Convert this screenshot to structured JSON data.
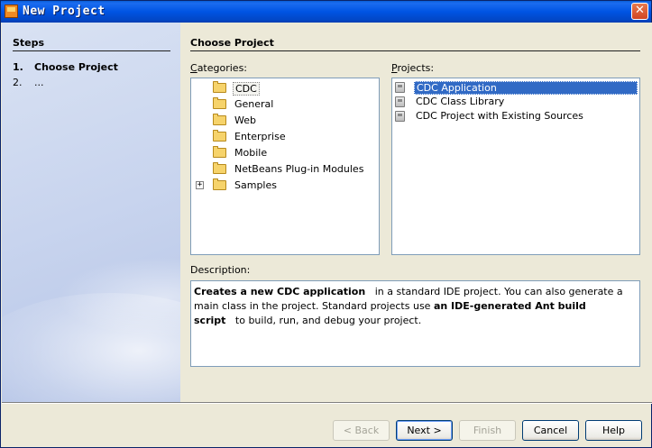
{
  "window": {
    "title": "New Project",
    "close_glyph": "✕",
    "icon": "netbeans-project-icon"
  },
  "steps": {
    "heading": "Steps",
    "items": [
      {
        "num": "1.",
        "label": "Choose Project",
        "current": true
      },
      {
        "num": "2.",
        "label": "...",
        "current": false
      }
    ]
  },
  "main": {
    "heading": "Choose Project",
    "categories_label": "Categories:",
    "projects_label": "Projects:",
    "description_label": "Description:",
    "categories": [
      {
        "label": "CDC",
        "selected": true,
        "expandable": false
      },
      {
        "label": "General",
        "selected": false,
        "expandable": false
      },
      {
        "label": "Web",
        "selected": false,
        "expandable": false
      },
      {
        "label": "Enterprise",
        "selected": false,
        "expandable": false
      },
      {
        "label": "Mobile",
        "selected": false,
        "expandable": false
      },
      {
        "label": "NetBeans Plug-in Modules",
        "selected": false,
        "expandable": false
      },
      {
        "label": "Samples",
        "selected": false,
        "expandable": true
      }
    ],
    "expander_glyph": "+",
    "projects": [
      {
        "label": "CDC Application",
        "selected": true
      },
      {
        "label": "CDC Class Library",
        "selected": false
      },
      {
        "label": "CDC Project with Existing Sources",
        "selected": false
      }
    ],
    "description": {
      "part1_bold": "Creates a new CDC application",
      "part2": "in a standard IDE project. You can also generate a main class in the project. Standard projects use",
      "part3_bold": "an IDE-generated Ant build script",
      "part4": "to build, run, and debug your project."
    }
  },
  "buttons": {
    "back": "< Back",
    "next": "Next >",
    "finish": "Finish",
    "cancel": "Cancel",
    "help": "Help"
  }
}
